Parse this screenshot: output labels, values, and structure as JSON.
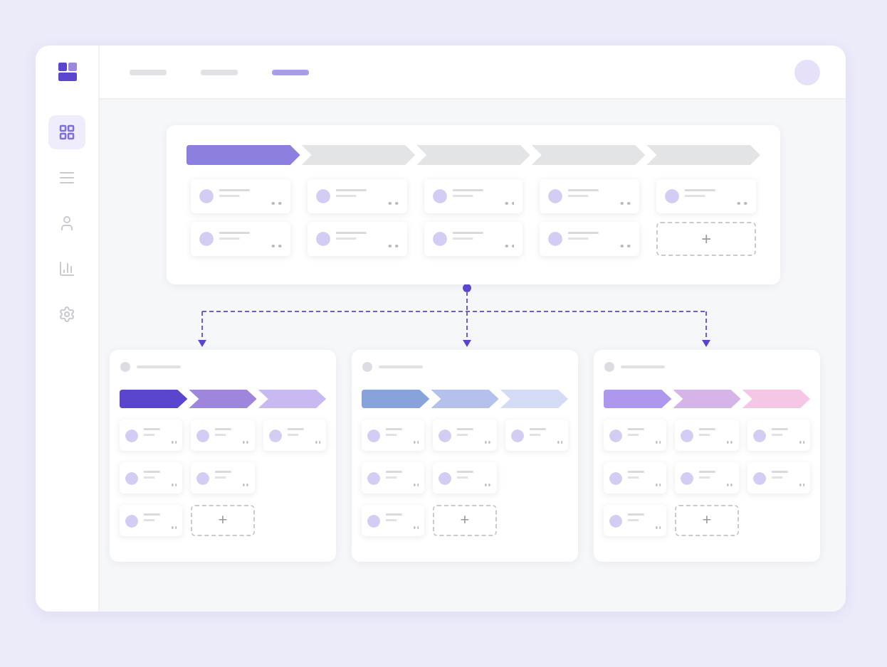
{
  "sidebar": {
    "items": [
      {
        "kind": "grid",
        "selected": true
      },
      {
        "kind": "list",
        "selected": false
      },
      {
        "kind": "user",
        "selected": false
      },
      {
        "kind": "chart",
        "selected": false
      },
      {
        "kind": "settings",
        "selected": false
      }
    ]
  },
  "header": {
    "tabs": [
      {
        "selected": false
      },
      {
        "selected": false
      },
      {
        "selected": true
      }
    ]
  },
  "main_board": {
    "stages": [
      {
        "color": "#8b7fe0"
      },
      {
        "color": "#e3e4e6"
      },
      {
        "color": "#e3e4e6"
      },
      {
        "color": "#e3e4e6"
      },
      {
        "color": "#e3e4e6"
      }
    ],
    "columns": [
      [
        {
          "kind": "card"
        },
        {
          "kind": "card"
        }
      ],
      [
        {
          "kind": "card"
        },
        {
          "kind": "card"
        }
      ],
      [
        {
          "kind": "card"
        },
        {
          "kind": "card"
        }
      ],
      [
        {
          "kind": "card"
        },
        {
          "kind": "card"
        }
      ],
      [
        {
          "kind": "card"
        },
        {
          "kind": "add",
          "label": "+"
        }
      ]
    ]
  },
  "sub_boards": [
    {
      "stages": [
        {
          "color": "#5a45cf"
        },
        {
          "color": "#9d86dc"
        },
        {
          "color": "#c9b9f2"
        }
      ],
      "columns": [
        [
          {
            "kind": "card"
          },
          {
            "kind": "card"
          },
          {
            "kind": "card"
          }
        ],
        [
          {
            "kind": "card"
          },
          {
            "kind": "card"
          },
          {
            "kind": "add",
            "label": "+"
          }
        ],
        [
          {
            "kind": "card"
          }
        ]
      ]
    },
    {
      "stages": [
        {
          "color": "#88a3dc"
        },
        {
          "color": "#b3c1ec"
        },
        {
          "color": "#d4dbf5"
        }
      ],
      "columns": [
        [
          {
            "kind": "card"
          },
          {
            "kind": "card"
          },
          {
            "kind": "card"
          }
        ],
        [
          {
            "kind": "card"
          },
          {
            "kind": "card"
          },
          {
            "kind": "add",
            "label": "+"
          }
        ],
        [
          {
            "kind": "card"
          }
        ]
      ]
    },
    {
      "stages": [
        {
          "color": "#ad98ee"
        },
        {
          "color": "#d5b4e8"
        },
        {
          "color": "#f5c6e6"
        }
      ],
      "columns": [
        [
          {
            "kind": "card"
          },
          {
            "kind": "card"
          },
          {
            "kind": "card"
          }
        ],
        [
          {
            "kind": "card"
          },
          {
            "kind": "card"
          },
          {
            "kind": "add",
            "label": "+"
          }
        ],
        [
          {
            "kind": "card"
          },
          {
            "kind": "card"
          }
        ]
      ]
    }
  ]
}
